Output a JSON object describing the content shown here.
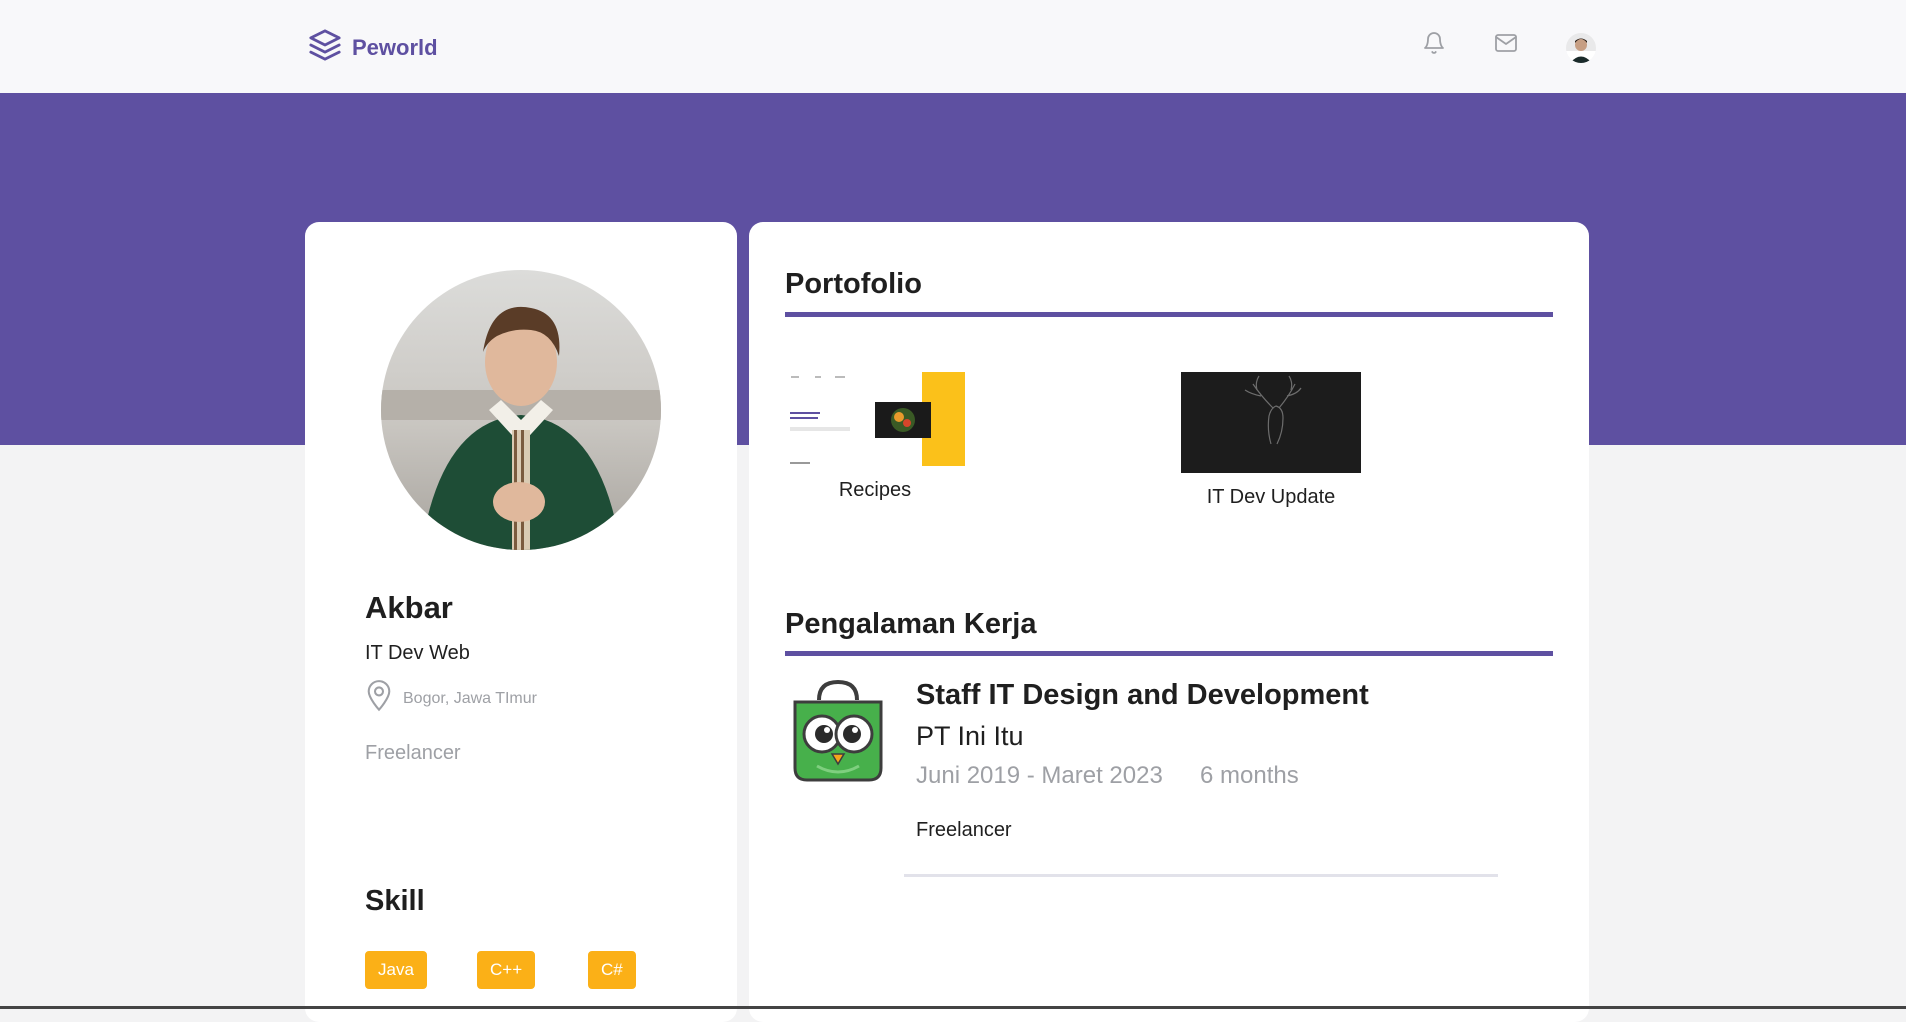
{
  "navbar": {
    "brand_name": "Peworld",
    "icons": [
      "layers-logo-icon",
      "bell-icon",
      "mail-icon",
      "user-avatar"
    ]
  },
  "colors": {
    "primary": "#5e50a1",
    "accent": "#fbb017",
    "muted_text": "#9ea0a5",
    "background": "#f3f3f4"
  },
  "profile": {
    "name": "Akbar",
    "title": "IT Dev Web",
    "location": "Bogor, Jawa TImur",
    "job_type": "Freelancer",
    "skill_heading": "Skill",
    "skills": [
      "Java",
      "C++",
      "C#"
    ]
  },
  "portfolio": {
    "heading": "Portofolio",
    "items": [
      {
        "label": "Recipes"
      },
      {
        "label": "IT Dev Update"
      }
    ]
  },
  "experience": {
    "heading": "Pengalaman Kerja",
    "items": [
      {
        "role": "Staff IT Design and Development",
        "company": "PT Ini Itu",
        "dates": "Juni 2019 - Maret 2023",
        "duration": "6 months",
        "description": "Freelancer"
      }
    ]
  }
}
